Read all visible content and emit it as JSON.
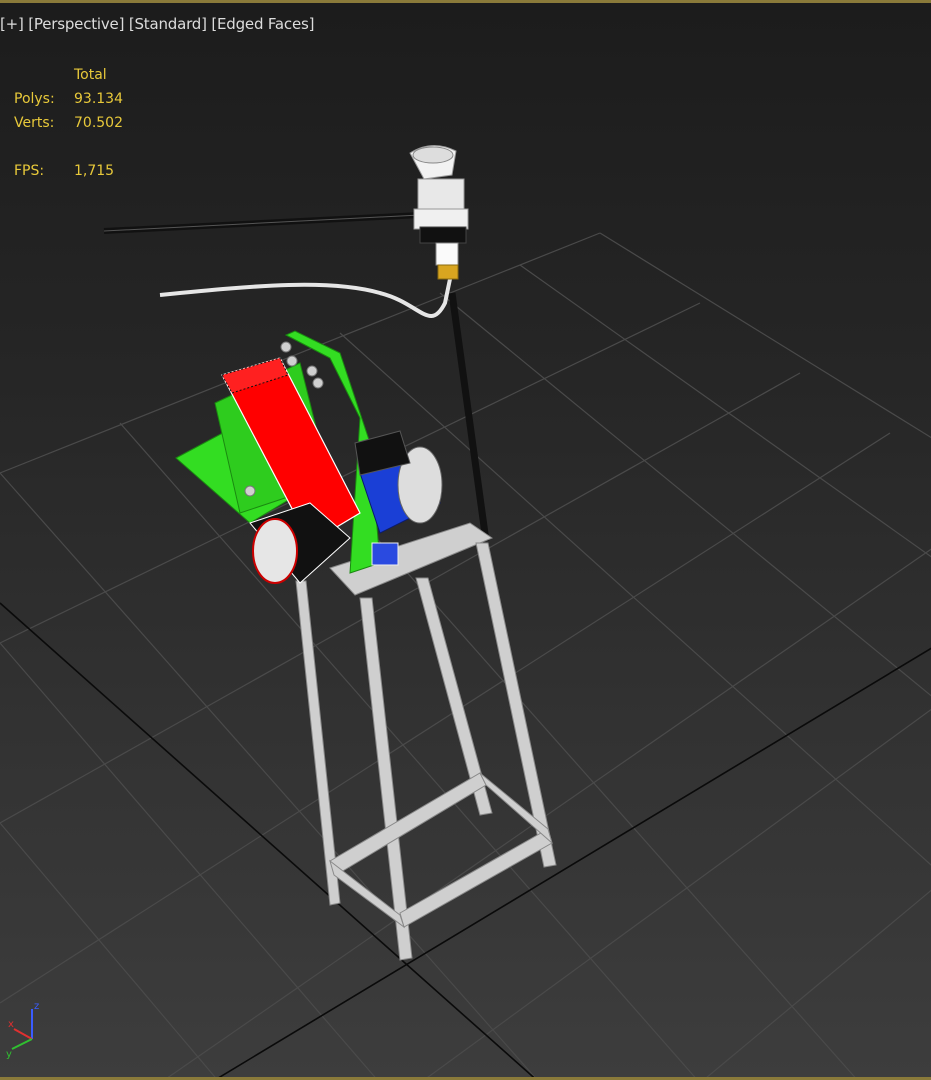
{
  "viewport": {
    "labels": [
      "[+]",
      "[Perspective]",
      "[Standard]",
      "[Edged Faces]"
    ]
  },
  "stats": {
    "header": "Total",
    "polys_label": "Polys:",
    "polys_value": "93.134",
    "verts_label": "Verts:",
    "verts_value": "70.502",
    "fps_label": "FPS:",
    "fps_value": "1,715"
  },
  "gizmo": {
    "z": "z",
    "x": "x",
    "y": "y"
  },
  "colors": {
    "stats_text": "#e8c93a",
    "label_text": "#dcdcdc",
    "grid": "#505050",
    "belt": "#ff0000",
    "frame_green": "#33dd22",
    "motor_blue": "#1a3fd6",
    "stand": "#cfcfcf"
  }
}
